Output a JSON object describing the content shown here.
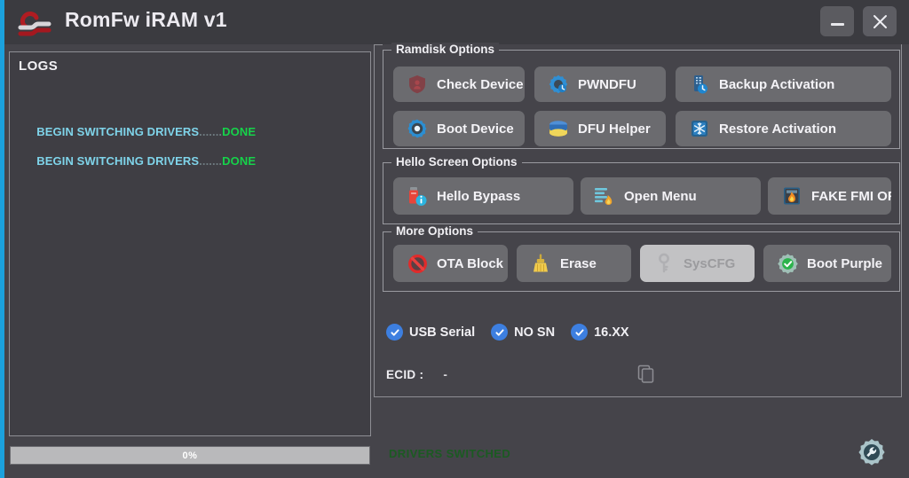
{
  "window": {
    "title": "RomFw iRAM v1",
    "logo_icon": "romfw-logo-icon",
    "minimize_label": "–",
    "close_label": "×"
  },
  "logs": {
    "title": "LOGS",
    "lines": [
      {
        "label": "BEGIN SWITCHING DRIVERS",
        "dots": ".......",
        "status": "DONE"
      },
      {
        "label": "BEGIN SWITCHING DRIVERS",
        "dots": ".......",
        "status": "DONE"
      }
    ]
  },
  "progress": {
    "percent_label": "0%",
    "percent_value": 0
  },
  "status": {
    "message": "DRIVERS SWITCHED",
    "color": "#1b5a22"
  },
  "settings": {
    "icon": "gear-wrench-icon"
  },
  "groups": {
    "ramdisk": {
      "legend": "Ramdisk Options",
      "buttons": [
        {
          "label": "Check Device",
          "icon": "shield-red-icon",
          "disabled": false
        },
        {
          "label": "PWNDFU",
          "icon": "gear-blue-icon",
          "disabled": false
        },
        {
          "label": "Backup Activation",
          "icon": "backup-blue-icon",
          "disabled": false
        },
        {
          "label": "Boot Device",
          "icon": "gear-boot-icon",
          "disabled": false
        },
        {
          "label": "DFU Helper",
          "icon": "disk-yellow-icon",
          "disabled": false
        },
        {
          "label": "Restore Activation",
          "icon": "snowflake-blue-icon",
          "disabled": false
        }
      ]
    },
    "hello": {
      "legend": "Hello Screen Options",
      "buttons": [
        {
          "label": "Hello Bypass",
          "icon": "usb-info-icon",
          "disabled": false
        },
        {
          "label": "Open Menu",
          "icon": "menu-list-icon",
          "disabled": false
        },
        {
          "label": "FAKE FMI OFF",
          "icon": "flame-icon",
          "disabled": false
        }
      ]
    },
    "more": {
      "legend": "More Options",
      "buttons": [
        {
          "label": "OTA Block",
          "icon": "block-red-icon",
          "disabled": false
        },
        {
          "label": "Erase",
          "icon": "broom-icon",
          "disabled": false
        },
        {
          "label": "SysCFG",
          "icon": "key-icon",
          "disabled": true
        },
        {
          "label": "Boot Purple",
          "icon": "gear-check-icon",
          "disabled": false
        }
      ]
    }
  },
  "checkboxes": [
    {
      "label": "USB Serial",
      "checked": true
    },
    {
      "label": "NO SN",
      "checked": true
    },
    {
      "label": "16.XX",
      "checked": true
    }
  ],
  "ecid": {
    "label": "ECID :",
    "value": "-",
    "copy_icon": "copy-icon"
  },
  "colors": {
    "window_bg": "#45444a",
    "titlebar_bg": "#3b3b40",
    "accent_blue": "#1ba1dd",
    "button_bg": "#6b6b6f",
    "log_text": "#7fd4ea",
    "log_done": "#16d24a",
    "checkbox_blue": "#3d7fe0"
  }
}
